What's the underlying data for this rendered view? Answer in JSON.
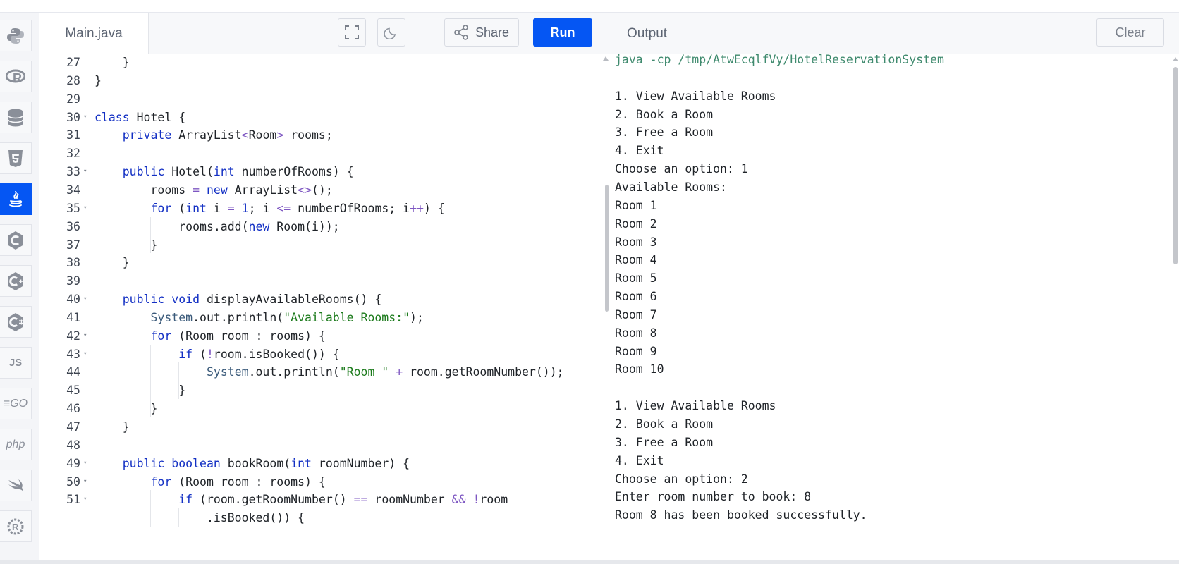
{
  "sidebar": {
    "items": [
      {
        "name": "python",
        "icon": "python-icon"
      },
      {
        "name": "r",
        "icon": "r-icon"
      },
      {
        "name": "sql",
        "icon": "database-icon"
      },
      {
        "name": "html",
        "icon": "html5-icon"
      },
      {
        "name": "java",
        "icon": "java-icon",
        "active": true
      },
      {
        "name": "c",
        "icon": "c-icon"
      },
      {
        "name": "cpp",
        "icon": "cpp-icon"
      },
      {
        "name": "csharp",
        "icon": "csharp-icon"
      },
      {
        "name": "js",
        "label": "JS"
      },
      {
        "name": "go",
        "label": "GO"
      },
      {
        "name": "php",
        "label": "php"
      },
      {
        "name": "swift",
        "icon": "swift-icon"
      },
      {
        "name": "rust",
        "icon": "rust-icon"
      }
    ]
  },
  "editor": {
    "file_tab": "Main.java",
    "share_label": "Share",
    "run_label": "Run"
  },
  "output_panel": {
    "title": "Output",
    "clear_label": "Clear",
    "lines": [
      "java -cp /tmp/AtwEcqlfVy/HotelReservationSystem",
      "",
      "1. View Available Rooms",
      "2. Book a Room",
      "3. Free a Room",
      "4. Exit",
      "Choose an option: 1",
      "Available Rooms:",
      "Room 1",
      "Room 2",
      "Room 3",
      "Room 4",
      "Room 5",
      "Room 6",
      "Room 7",
      "Room 8",
      "Room 9",
      "Room 10",
      "",
      "1. View Available Rooms",
      "2. Book a Room",
      "3. Free a Room",
      "4. Exit",
      "Choose an option: 2",
      "Enter room number to book: 8",
      "Room 8 has been booked successfully."
    ]
  },
  "code": {
    "line_numbers": [
      "27",
      "28",
      "29",
      "30",
      "31",
      "32",
      "33",
      "34",
      "35",
      "36",
      "37",
      "38",
      "39",
      "40",
      "41",
      "42",
      "43",
      "44",
      "45",
      "46",
      "47",
      "48",
      "49",
      "50",
      "51",
      ""
    ],
    "fold_lines": [
      "30",
      "33",
      "35",
      "40",
      "42",
      "43",
      "49",
      "50",
      "51"
    ],
    "lines": [
      [
        {
          "t": "    }"
        }
      ],
      [
        {
          "t": "}"
        }
      ],
      [
        {
          "t": ""
        }
      ],
      [
        {
          "t": "class",
          "c": "kw"
        },
        {
          "t": " Hotel {"
        }
      ],
      [
        {
          "t": "    "
        },
        {
          "t": "private",
          "c": "kw"
        },
        {
          "t": " ArrayList"
        },
        {
          "t": "<",
          "c": "op"
        },
        {
          "t": "Room"
        },
        {
          "t": ">",
          "c": "op"
        },
        {
          "t": " rooms;"
        }
      ],
      [
        {
          "t": ""
        }
      ],
      [
        {
          "t": "    "
        },
        {
          "t": "public",
          "c": "kw"
        },
        {
          "t": " Hotel("
        },
        {
          "t": "int",
          "c": "kw"
        },
        {
          "t": " numberOfRooms) {"
        }
      ],
      [
        {
          "t": "        rooms "
        },
        {
          "t": "=",
          "c": "op"
        },
        {
          "t": " "
        },
        {
          "t": "new",
          "c": "kw"
        },
        {
          "t": " ArrayList"
        },
        {
          "t": "<>",
          "c": "op"
        },
        {
          "t": "();"
        }
      ],
      [
        {
          "t": "        "
        },
        {
          "t": "for",
          "c": "kw"
        },
        {
          "t": " ("
        },
        {
          "t": "int",
          "c": "kw"
        },
        {
          "t": " i "
        },
        {
          "t": "=",
          "c": "op"
        },
        {
          "t": " "
        },
        {
          "t": "1",
          "c": "num"
        },
        {
          "t": "; i "
        },
        {
          "t": "<=",
          "c": "op"
        },
        {
          "t": " numberOfRooms; i"
        },
        {
          "t": "++",
          "c": "op"
        },
        {
          "t": ") {"
        }
      ],
      [
        {
          "t": "            rooms.add("
        },
        {
          "t": "new",
          "c": "kw"
        },
        {
          "t": " Room(i));"
        }
      ],
      [
        {
          "t": "        }"
        }
      ],
      [
        {
          "t": "    }"
        }
      ],
      [
        {
          "t": ""
        }
      ],
      [
        {
          "t": "    "
        },
        {
          "t": "public",
          "c": "kw"
        },
        {
          "t": " "
        },
        {
          "t": "void",
          "c": "kw"
        },
        {
          "t": " displayAvailableRooms() {"
        }
      ],
      [
        {
          "t": "        "
        },
        {
          "t": "System",
          "c": "sys"
        },
        {
          "t": ".out.println("
        },
        {
          "t": "\"Available Rooms:\"",
          "c": "str"
        },
        {
          "t": ");"
        }
      ],
      [
        {
          "t": "        "
        },
        {
          "t": "for",
          "c": "kw"
        },
        {
          "t": " (Room room : rooms) {"
        }
      ],
      [
        {
          "t": "            "
        },
        {
          "t": "if",
          "c": "kw"
        },
        {
          "t": " ("
        },
        {
          "t": "!",
          "c": "op"
        },
        {
          "t": "room.isBooked()) {"
        }
      ],
      [
        {
          "t": "                "
        },
        {
          "t": "System",
          "c": "sys"
        },
        {
          "t": ".out.println("
        },
        {
          "t": "\"Room \"",
          "c": "str"
        },
        {
          "t": " "
        },
        {
          "t": "+",
          "c": "op"
        },
        {
          "t": " room.getRoomNumber());"
        }
      ],
      [
        {
          "t": "            }"
        }
      ],
      [
        {
          "t": "        }"
        }
      ],
      [
        {
          "t": "    }"
        }
      ],
      [
        {
          "t": ""
        }
      ],
      [
        {
          "t": "    "
        },
        {
          "t": "public",
          "c": "kw"
        },
        {
          "t": " "
        },
        {
          "t": "boolean",
          "c": "kw"
        },
        {
          "t": " bookRoom("
        },
        {
          "t": "int",
          "c": "kw"
        },
        {
          "t": " roomNumber) {"
        }
      ],
      [
        {
          "t": "        "
        },
        {
          "t": "for",
          "c": "kw"
        },
        {
          "t": " (Room room : rooms) {"
        }
      ],
      [
        {
          "t": "            "
        },
        {
          "t": "if",
          "c": "kw"
        },
        {
          "t": " (room.getRoomNumber() "
        },
        {
          "t": "==",
          "c": "op"
        },
        {
          "t": " roomNumber "
        },
        {
          "t": "&&",
          "c": "op"
        },
        {
          "t": " "
        },
        {
          "t": "!",
          "c": "op"
        },
        {
          "t": "room"
        }
      ],
      [
        {
          "t": "                .isBooked()) {"
        }
      ]
    ]
  },
  "colors": {
    "accent": "#0556f3",
    "keyword": "#1330c4",
    "string": "#1b7a1b",
    "command": "#3f8a6e"
  }
}
